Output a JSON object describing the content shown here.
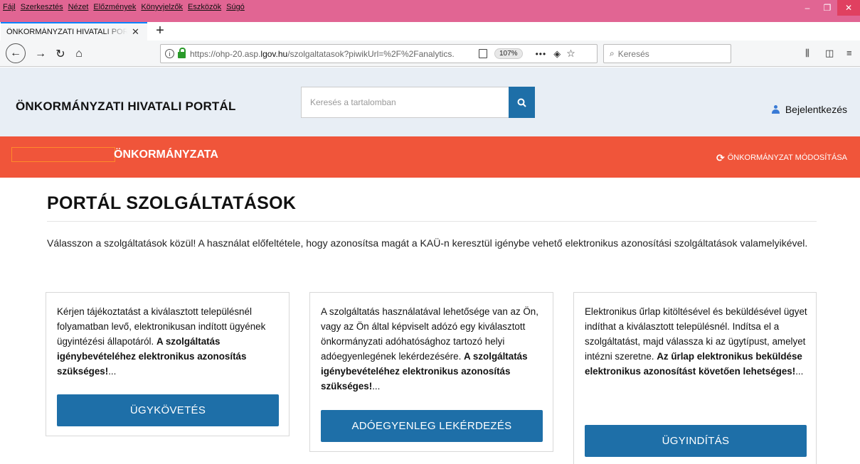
{
  "browser": {
    "menu": [
      "Fájl",
      "Szerkesztés",
      "Nézet",
      "Előzmények",
      "Könyvjelzők",
      "Eszközök",
      "Súgó"
    ],
    "window_controls": {
      "minimize": "–",
      "restore": "❐",
      "close": "✕"
    },
    "tab_title": "ÖNKORMÁNYZATI HIVATALI PORTÁL",
    "tab_close": "✕",
    "new_tab": "+",
    "url_prefix": "https://ohp-20.asp.",
    "url_host": "lgov.hu",
    "url_path": "/szolgaltatasok?piwikUrl=%2F%2Fanalytics.",
    "zoom": "107%",
    "more": "•••",
    "search_placeholder": "Keresés",
    "icons": [
      "back-icon",
      "forward-icon",
      "reload-icon",
      "home-icon",
      "info-icon",
      "lock-icon",
      "reader-icon",
      "pocket-icon",
      "bookmark-star-icon",
      "library-icon",
      "sidebar-icon",
      "hamburger-menu-icon"
    ]
  },
  "header": {
    "portal_title": "ÖNKORMÁNYZATI HIVATALI PORTÁL",
    "search_placeholder": "Keresés a tartalomban",
    "login_label": "Bejelentkezés"
  },
  "municipality": {
    "name_suffix": "ÖNKORMÁNYZATA",
    "change_label": "ÖNKORMÁNYZAT MÓDOSÍTÁSA"
  },
  "main": {
    "title": "PORTÁL SZOLGÁLTATÁSOK",
    "intro": "Válasszon a szolgáltatások közül! A használat előfeltétele, hogy azonosítsa magát a KAÜ-n keresztül igénybe vehető elektronikus azonosítási szolgáltatások valamelyikével.",
    "cards": [
      {
        "text": "Kérjen tájékoztatást a kiválasztott településnél folyamatban levő, elektronikusan indított ügyének ügyintézési állapotáról. ",
        "bold": "A szolgáltatás igénybevételéhez elektronikus azonosítás szükséges!",
        "ellipsis": "...",
        "button": "ÜGYKÖVETÉS"
      },
      {
        "text": "A szolgáltatás használatával lehetősége van az Ön, vagy az Ön által képviselt adózó egy kiválasztott önkormányzati adóhatósághoz tartozó helyi adóegyenlegének lekérdezésére. ",
        "bold": "A szolgáltatás igénybevételéhez elektronikus azonosítás szükséges!",
        "ellipsis": "...",
        "button": "ADÓEGYENLEG LEKÉRDEZÉS"
      },
      {
        "text": "Elektronikus űrlap kitöltésével és beküldésével ügyet indíthat a kiválasztott településnél. Indítsa el a szolgáltatást, majd válassza ki az ügytípust, amelyet intézni szeretne. ",
        "bold": "Az űrlap elektronikus beküldése elektronikus azonosítást követően lehetséges!",
        "ellipsis": "...",
        "button": "ÜGYINDÍTÁS"
      }
    ]
  },
  "colors": {
    "titlebar": "#e16593",
    "accent_blue": "#1e6fa8",
    "municipality_bar": "#f0553a",
    "header_bg": "#e8eef5"
  }
}
